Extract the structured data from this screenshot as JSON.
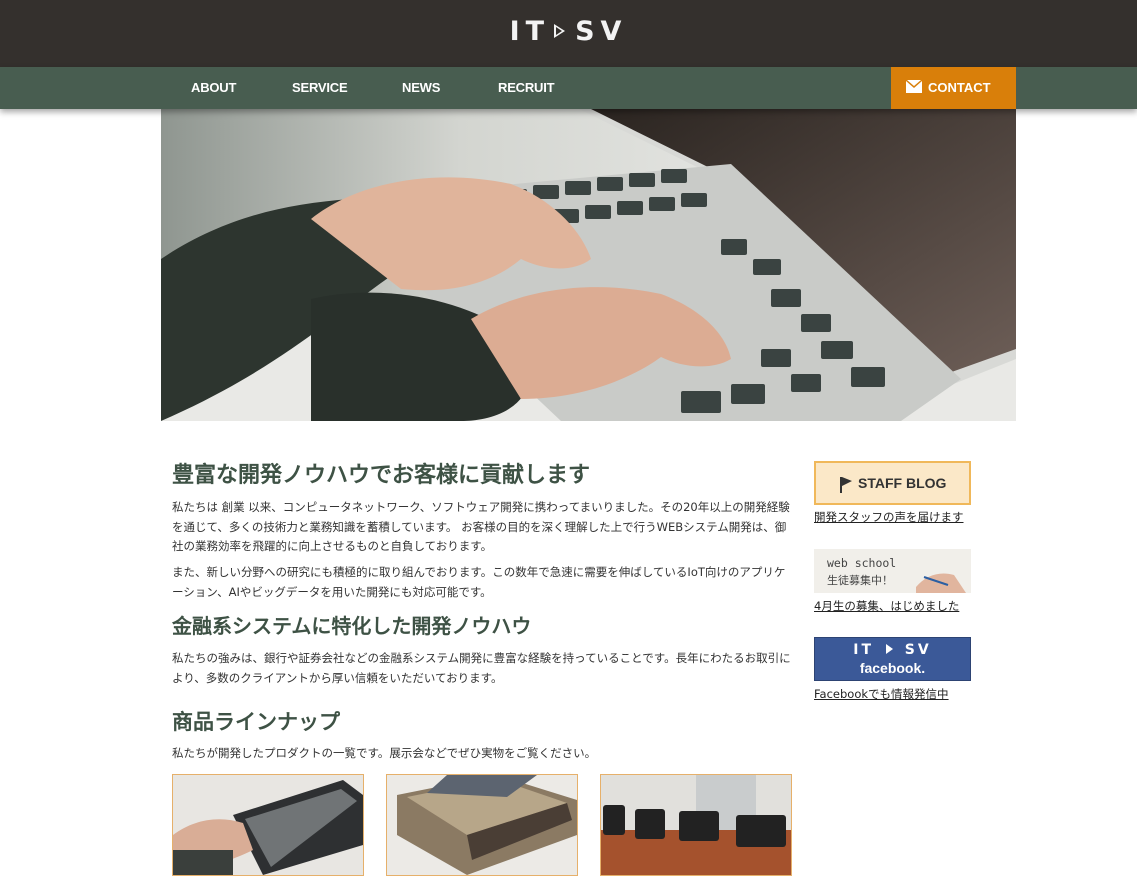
{
  "header": {
    "logo_left": "IT",
    "logo_right": "SV"
  },
  "nav": {
    "items": [
      "ABOUT",
      "SERVICE",
      "NEWS",
      "RECRUIT"
    ],
    "contact": "CONTACT"
  },
  "main": {
    "heading1": "豊富な開発ノウハウでお客様に貢献します",
    "para1": "私たちは 創業 以来、コンピュータネットワーク、ソフトウェア開発に携わってまいりました。その20年以上の開発経験を通じて、多くの技術力と業務知識を蓄積しています。 お客様の目的を深く理解した上で行うWEBシステム開発は、御社の業務効率を飛躍的に向上させるものと自負しております。",
    "para2": "また、新しい分野への研究にも積極的に取り組んでおります。この数年で急速に需要を伸ばしているIoT向けのアプリケーション、AIやビッグデータを用いた開発にも対応可能です。",
    "heading2": "金融系システムに特化した開発ノウハウ",
    "para3": "私たちの強みは、銀行や証券会社などの金融系システム開発に豊富な経験を持っていることです。長年にわたるお取引により、多数のクライアントから厚い信頼をいただいております。",
    "heading3": "商品ラインナップ",
    "para4": "私たちが開発したプロダクトの一覧です。展示会などでぜひ実物をご覧ください。"
  },
  "sidebar": {
    "blog_banner": "STAFF BLOG",
    "blog_link": "開発スタッフの声を届けます",
    "school_line1": "web school",
    "school_line2": "生徒募集中！",
    "school_link": "4月生の募集、はじめました",
    "fb_logo_left": "IT",
    "fb_logo_right": "SV",
    "fb_word": "facebook.",
    "fb_link": "Facebookでも情報発信中"
  },
  "colors": {
    "topbar": "#34302d",
    "nav": "#485d50",
    "contact": "#d97f0a",
    "heading": "#3e5245",
    "facebook": "#3b5998"
  }
}
